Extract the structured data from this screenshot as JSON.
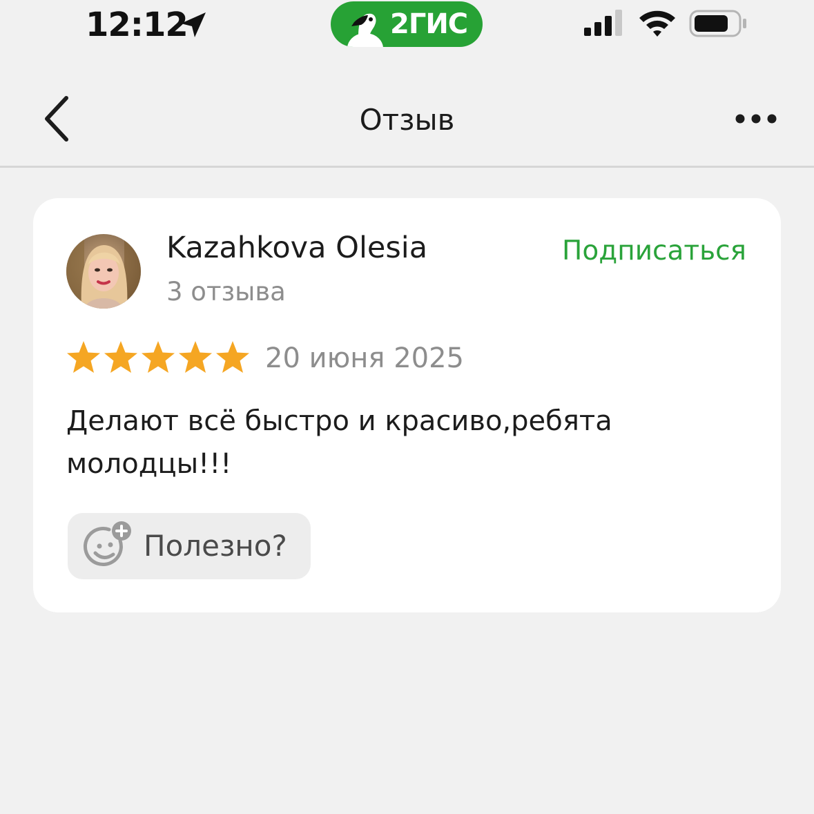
{
  "status_bar": {
    "time": "12:12",
    "app_badge": "2ГИС",
    "icons": [
      "location-arrow-icon",
      "goose-icon",
      "signal-icon",
      "wifi-icon",
      "battery-icon"
    ]
  },
  "nav": {
    "title": "Отзыв",
    "back_icon": "chevron-left-icon",
    "more_icon": "more-dots-icon"
  },
  "review": {
    "author": "Kazahkova Olesia",
    "review_count": "3 отзыва",
    "subscribe_label": "Подписаться",
    "rating": 5,
    "rating_max": 5,
    "date": "20 июня 2025",
    "text": "Делают всё быстро и красиво,ребята молодцы!!!",
    "helpful_label": "Полезно?",
    "helpful_icon": "smile-plus-icon"
  },
  "colors": {
    "background": "#f1f1f1",
    "card": "#ffffff",
    "brand_green": "#27a235",
    "subscribe_green": "#2aa33a",
    "star_gold": "#f5a623",
    "muted_text": "#8d8d8d"
  }
}
